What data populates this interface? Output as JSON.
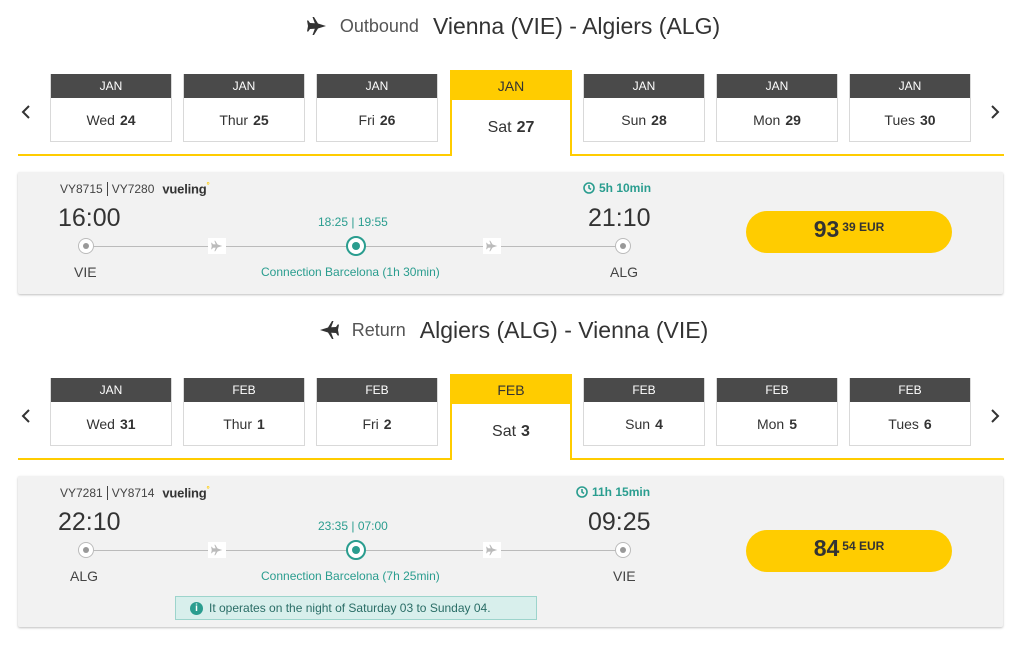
{
  "outbound": {
    "direction": "Outbound",
    "route": "Vienna (VIE) - Algiers (ALG)",
    "dates": [
      {
        "month": "JAN",
        "weekday": "Wed",
        "day": "24"
      },
      {
        "month": "JAN",
        "weekday": "Thur",
        "day": "25"
      },
      {
        "month": "JAN",
        "weekday": "Fri",
        "day": "26"
      },
      {
        "month": "JAN",
        "weekday": "Sat",
        "day": "27"
      },
      {
        "month": "JAN",
        "weekday": "Sun",
        "day": "28"
      },
      {
        "month": "JAN",
        "weekday": "Mon",
        "day": "29"
      },
      {
        "month": "JAN",
        "weekday": "Tues",
        "day": "30"
      }
    ],
    "selected_index": 3,
    "flight": {
      "flight_1": "VY8715",
      "flight_2": "VY7280",
      "airline": "vueling",
      "duration": "5h 10min",
      "dep_time": "16:00",
      "arr_time": "21:10",
      "conn_times": "18:25 | 19:55",
      "dep_airport": "VIE",
      "arr_airport": "ALG",
      "connection": "Connection Barcelona (1h 30min)",
      "price_int": "93",
      "price_dec": "39 EUR"
    }
  },
  "return": {
    "direction": "Return",
    "route": "Algiers (ALG) - Vienna (VIE)",
    "dates": [
      {
        "month": "JAN",
        "weekday": "Wed",
        "day": "31"
      },
      {
        "month": "FEB",
        "weekday": "Thur",
        "day": "1"
      },
      {
        "month": "FEB",
        "weekday": "Fri",
        "day": "2"
      },
      {
        "month": "FEB",
        "weekday": "Sat",
        "day": "3"
      },
      {
        "month": "FEB",
        "weekday": "Sun",
        "day": "4"
      },
      {
        "month": "FEB",
        "weekday": "Mon",
        "day": "5"
      },
      {
        "month": "FEB",
        "weekday": "Tues",
        "day": "6"
      }
    ],
    "selected_index": 3,
    "flight": {
      "flight_1": "VY7281",
      "flight_2": "VY8714",
      "airline": "vueling",
      "duration": "11h 15min",
      "dep_time": "22:10",
      "arr_time": "09:25",
      "conn_times": "23:35 | 07:00",
      "dep_airport": "ALG",
      "arr_airport": "VIE",
      "connection": "Connection Barcelona (7h 25min)",
      "note": "It operates on the night of Saturday 03 to Sunday 04.",
      "price_int": "84",
      "price_dec": "54 EUR"
    }
  },
  "colors": {
    "accent": "#ffcc00",
    "teal": "#2a9d8f",
    "dark_tab": "#4a4a4a"
  },
  "icons": [
    "plane-right-icon",
    "plane-left-icon",
    "chevron-left-icon",
    "chevron-right-icon",
    "clock-icon",
    "info-icon"
  ]
}
